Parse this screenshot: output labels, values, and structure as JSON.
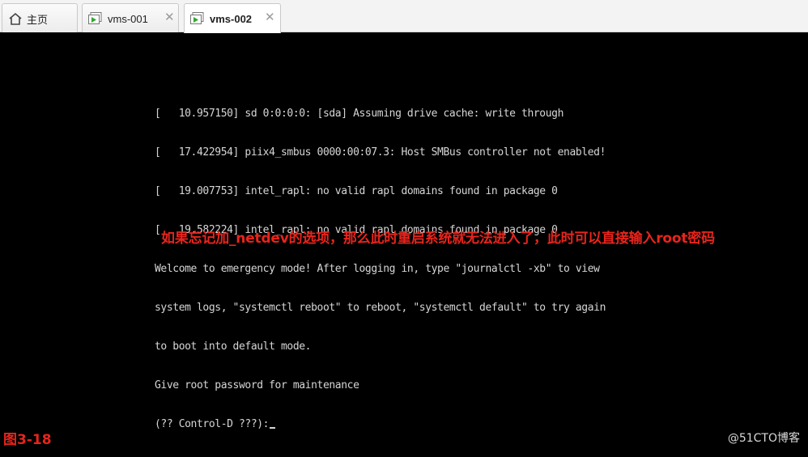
{
  "tabs": [
    {
      "label": "主页",
      "icon": "home-icon",
      "active": false,
      "closable": false
    },
    {
      "label": "vms-001",
      "icon": "vm-icon",
      "active": false,
      "closable": true
    },
    {
      "label": "vms-002",
      "icon": "vm-icon",
      "active": true,
      "closable": true
    }
  ],
  "colors": {
    "annotation": "#e8241c",
    "console_background": "#000000",
    "console_text": "#d6d6d6"
  },
  "console": {
    "lines": [
      "[   10.957150] sd 0:0:0:0: [sda] Assuming drive cache: write through",
      "[   17.422954] piix4_smbus 0000:00:07.3: Host SMBus controller not enabled!",
      "[   19.007753] intel_rapl: no valid rapl domains found in package 0",
      "[   19.582224] intel_rapl: no valid rapl domains found in package 0",
      "Welcome to emergency mode! After logging in, type \"journalctl -xb\" to view",
      "system logs, \"systemctl reboot\" to reboot, \"systemctl default\" to try again",
      "to boot into default mode.",
      "Give root password for maintenance",
      "(?? Control-D ???):"
    ]
  },
  "annotation": "如果忘记加_netdev的选项，那么此时重启系统就无法进入了，此时可以直接输入root密码",
  "figure_label": "图3-18",
  "watermark": "@51CTO博客"
}
